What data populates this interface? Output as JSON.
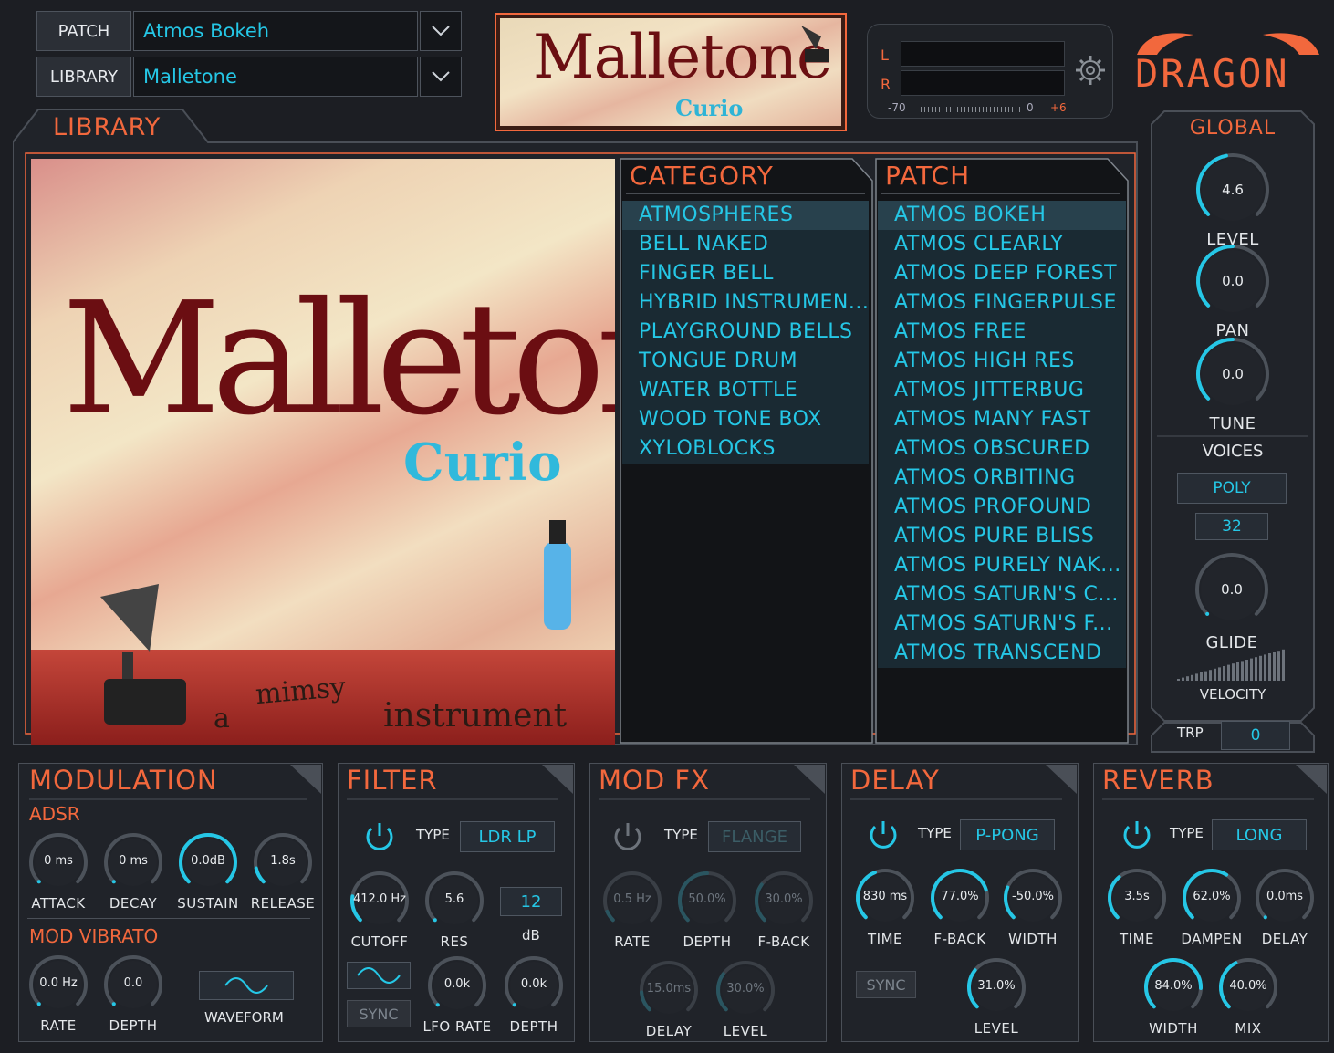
{
  "header": {
    "patch_label": "PATCH",
    "patch_value": "Atmos Bokeh",
    "library_label": "LIBRARY",
    "library_value": "Malletone",
    "logo_title": "Malletone",
    "logo_sub": "Curio",
    "meter": {
      "left": "L",
      "right": "R",
      "scale_min": "-70",
      "scale_zero": "0",
      "scale_max": "+6"
    },
    "brand": "DRAGON"
  },
  "library_tab": "LIBRARY",
  "artwork": {
    "title": "Malletone",
    "subtitle": "Curio",
    "tagline_a": "a",
    "tagline_b": "mimsy",
    "tagline_c": "instrument"
  },
  "category": {
    "title": "CATEGORY",
    "items": [
      "ATMOSPHERES",
      "BELL NAKED",
      "FINGER BELL",
      "HYBRID INSTRUMEN...",
      "PLAYGROUND BELLS",
      "TONGUE DRUM",
      "WATER BOTTLE",
      "WOOD TONE BOX",
      "XYLOBLOCKS"
    ],
    "selected": 0
  },
  "patchlist": {
    "title": "PATCH",
    "items": [
      "ATMOS BOKEH",
      "ATMOS CLEARLY",
      "ATMOS DEEP FOREST",
      "ATMOS FINGERPULSE",
      "ATMOS FREE",
      "ATMOS HIGH RES",
      "ATMOS JITTERBUG",
      "ATMOS MANY FAST",
      "ATMOS OBSCURED",
      "ATMOS ORBITING",
      "ATMOS PROFOUND",
      "ATMOS PURE BLISS",
      "ATMOS PURELY NAK...",
      "ATMOS SATURN'S C...",
      "ATMOS SATURN'S F...",
      "ATMOS TRANSCEND"
    ],
    "selected": 0
  },
  "global": {
    "title": "GLOBAL",
    "level": {
      "value": "4.6",
      "label": "LEVEL"
    },
    "pan": {
      "value": "0.0",
      "label": "PAN"
    },
    "tune": {
      "value": "0.0",
      "label": "TUNE"
    },
    "voices_label": "VOICES",
    "voices_mode": "POLY",
    "voices_count": "32",
    "glide": {
      "value": "0.0",
      "label": "GLIDE"
    },
    "velocity_label": "VELOCITY",
    "trp_label": "TRP",
    "trp_value": "0"
  },
  "modulation": {
    "title": "MODULATION",
    "adsr": "ADSR",
    "attack": {
      "value": "0 ms",
      "label": "ATTACK"
    },
    "decay": {
      "value": "0 ms",
      "label": "DECAY"
    },
    "sustain": {
      "value": "0.0dB",
      "label": "SUSTAIN"
    },
    "release": {
      "value": "1.8s",
      "label": "RELEASE"
    },
    "vibrato": "MOD VIBRATO",
    "rate": {
      "value": "0.0 Hz",
      "label": "RATE"
    },
    "depth": {
      "value": "0.0",
      "label": "DEPTH"
    },
    "waveform": "WAVEFORM"
  },
  "filter": {
    "title": "FILTER",
    "type_label": "TYPE",
    "type": "LDR LP",
    "cutoff": {
      "value": "412.0 Hz",
      "label": "CUTOFF"
    },
    "res": {
      "value": "5.6",
      "label": "RES"
    },
    "db_value": "12",
    "db_label": "dB",
    "sync": "SYNC",
    "lfo_rate": {
      "value": "0.0k",
      "label": "LFO RATE"
    },
    "depth": {
      "value": "0.0k",
      "label": "DEPTH"
    }
  },
  "modfx": {
    "title": "MOD FX",
    "type_label": "TYPE",
    "type": "FLANGE",
    "rate": {
      "value": "0.5 Hz",
      "label": "RATE"
    },
    "depth": {
      "value": "50.0%",
      "label": "DEPTH"
    },
    "fback": {
      "value": "30.0%",
      "label": "F-BACK"
    },
    "delay": {
      "value": "15.0ms",
      "label": "DELAY"
    },
    "level": {
      "value": "30.0%",
      "label": "LEVEL"
    }
  },
  "delay": {
    "title": "DELAY",
    "type_label": "TYPE",
    "type": "P-PONG",
    "time": {
      "value": "830 ms",
      "label": "TIME"
    },
    "fback": {
      "value": "77.0%",
      "label": "F-BACK"
    },
    "width": {
      "value": "-50.0%",
      "label": "WIDTH"
    },
    "sync": "SYNC",
    "level": {
      "value": "31.0%",
      "label": "LEVEL"
    }
  },
  "reverb": {
    "title": "REVERB",
    "type_label": "TYPE",
    "type": "LONG",
    "time": {
      "value": "3.5s",
      "label": "TIME"
    },
    "dampen": {
      "value": "62.0%",
      "label": "DAMPEN"
    },
    "delay": {
      "value": "0.0ms",
      "label": "DELAY"
    },
    "width": {
      "value": "84.0%",
      "label": "WIDTH"
    },
    "mix": {
      "value": "40.0%",
      "label": "MIX"
    }
  },
  "colors": {
    "accent": "#25c7e6",
    "title": "#f2683d",
    "bg": "#1c1e23"
  }
}
